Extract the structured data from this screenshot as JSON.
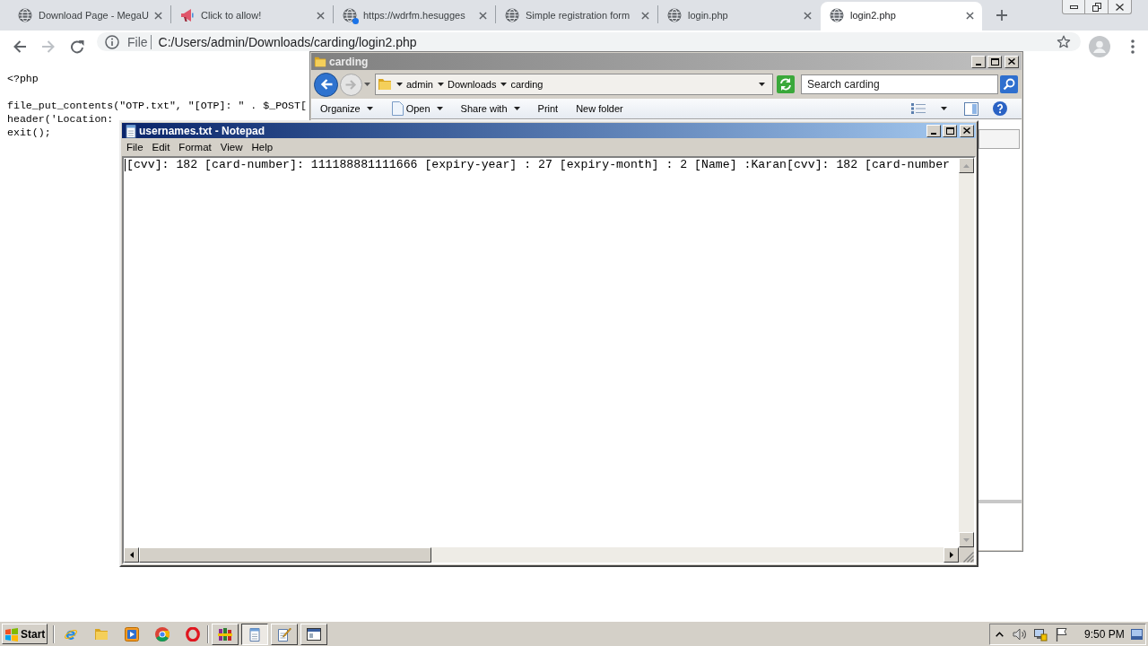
{
  "browser": {
    "tabs": [
      {
        "title": "Download Page - MegaU",
        "kind": "globe",
        "badge": false,
        "selected": false
      },
      {
        "title": "Click to allow!",
        "kind": "megaphone",
        "badge": false,
        "selected": false
      },
      {
        "title": "https://wdrfm.hesugges",
        "kind": "globe",
        "badge": true,
        "selected": false
      },
      {
        "title": "Simple registration form",
        "kind": "globe",
        "badge": false,
        "selected": false
      },
      {
        "title": "login.php",
        "kind": "globe",
        "badge": false,
        "selected": false
      },
      {
        "title": "login2.php",
        "kind": "globe",
        "badge": false,
        "selected": true
      }
    ],
    "address_bar": {
      "scheme": "File",
      "url": "C:/Users/admin/Downloads/carding/login2.php"
    }
  },
  "page": {
    "code_blocks": [
      [
        "<?php"
      ],
      [
        "file_put_contents(\"OTP.txt\", \"[OTP]: \" . $_POST[",
        "header('Location:",
        "exit();"
      ]
    ]
  },
  "explorer": {
    "title": "carding",
    "breadcrumb": [
      "admin",
      "Downloads",
      "carding"
    ],
    "search": {
      "placeholder": "Search carding"
    },
    "toolbar": [
      {
        "label": "Organize",
        "kind": "menu"
      },
      {
        "label": "Open",
        "kind": "icon-menu"
      },
      {
        "label": "Share with",
        "kind": "menu"
      },
      {
        "label": "Print",
        "kind": "plain"
      },
      {
        "label": "New folder",
        "kind": "plain"
      }
    ]
  },
  "notepad": {
    "title": "usernames.txt - Notepad",
    "menu": [
      "File",
      "Edit",
      "Format",
      "View",
      "Help"
    ],
    "text": "[cvv]: 182 [card-number]: 111188881111666 [expiry-year] : 27 [expiry-month] : 2 [Name] :Karan[cvv]: 182 [card-number"
  },
  "taskbar": {
    "start": "Start",
    "tasks": [
      {
        "kind": "archive",
        "selected": false
      },
      {
        "kind": "notepad",
        "selected": true
      },
      {
        "kind": "editor",
        "selected": false
      },
      {
        "kind": "window",
        "selected": false
      }
    ],
    "clock": "9:50 PM"
  }
}
